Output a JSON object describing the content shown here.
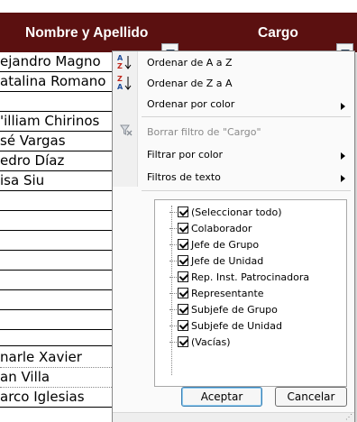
{
  "header": {
    "col_nombre": "Nombre y Apellido",
    "col_cargo": "Cargo",
    "bg_color": "#5b1010"
  },
  "rows": [
    "ejandro Magno",
    "atalina Romano",
    "",
    "'illiam Chirinos",
    "sé Vargas",
    "edro Díaz",
    "isa Siu",
    "",
    "",
    "",
    "",
    "",
    "",
    "",
    "narle Xavier",
    "an Villa",
    "arco Iglesias"
  ],
  "menu": {
    "sort_az": "Ordenar de A a Z",
    "sort_za": "Ordenar de Z a A",
    "sort_color": "Ordenar por color",
    "clear_filter": "Borrar filtro de \"Cargo\"",
    "filter_color": "Filtrar por color",
    "text_filters": "Filtros de texto"
  },
  "icons": {
    "sort_az": "sort-az-icon",
    "sort_za": "sort-za-icon",
    "clear_filter": "clear-filter-icon"
  },
  "checklist": [
    {
      "label": "(Seleccionar todo)",
      "checked": true
    },
    {
      "label": "Colaborador",
      "checked": true
    },
    {
      "label": "Jefe de Grupo",
      "checked": true
    },
    {
      "label": "Jefe de Unidad",
      "checked": true
    },
    {
      "label": "Rep. Inst. Patrocinadora",
      "checked": true
    },
    {
      "label": "Representante",
      "checked": true
    },
    {
      "label": "Subjefe de Grupo",
      "checked": true
    },
    {
      "label": "Subjefe de Unidad",
      "checked": true
    },
    {
      "label": "(Vacías)",
      "checked": true
    }
  ],
  "buttons": {
    "ok": "Aceptar",
    "cancel": "Cancelar"
  }
}
